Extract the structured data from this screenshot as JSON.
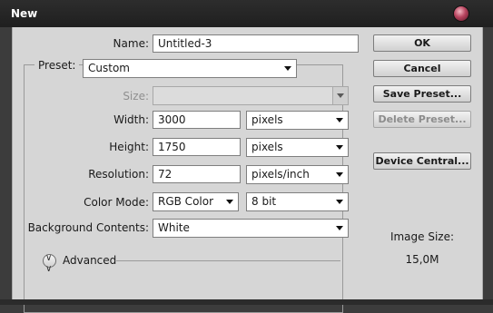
{
  "window": {
    "title": "New"
  },
  "form": {
    "name": {
      "label": "Name:",
      "value": "Untitled-3"
    },
    "preset": {
      "label": "Preset:",
      "value": "Custom"
    },
    "size": {
      "label": "Size:",
      "value": ""
    },
    "width": {
      "label": "Width:",
      "value": "3000",
      "unit": "pixels"
    },
    "height": {
      "label": "Height:",
      "value": "1750",
      "unit": "pixels"
    },
    "resolution": {
      "label": "Resolution:",
      "value": "72",
      "unit": "pixels/inch"
    },
    "color_mode": {
      "label": "Color Mode:",
      "value": "RGB Color",
      "depth": "8 bit"
    },
    "background": {
      "label": "Background Contents:",
      "value": "White"
    },
    "advanced": {
      "label": "Advanced"
    }
  },
  "buttons": {
    "ok": "OK",
    "cancel": "Cancel",
    "save_preset": "Save Preset...",
    "delete_preset": "Delete Preset...",
    "device_central": "Device Central..."
  },
  "image_size": {
    "label": "Image Size:",
    "value": "15,0M"
  },
  "icons": {
    "close": "close-icon",
    "advanced": "double-chevron-down-icon"
  }
}
